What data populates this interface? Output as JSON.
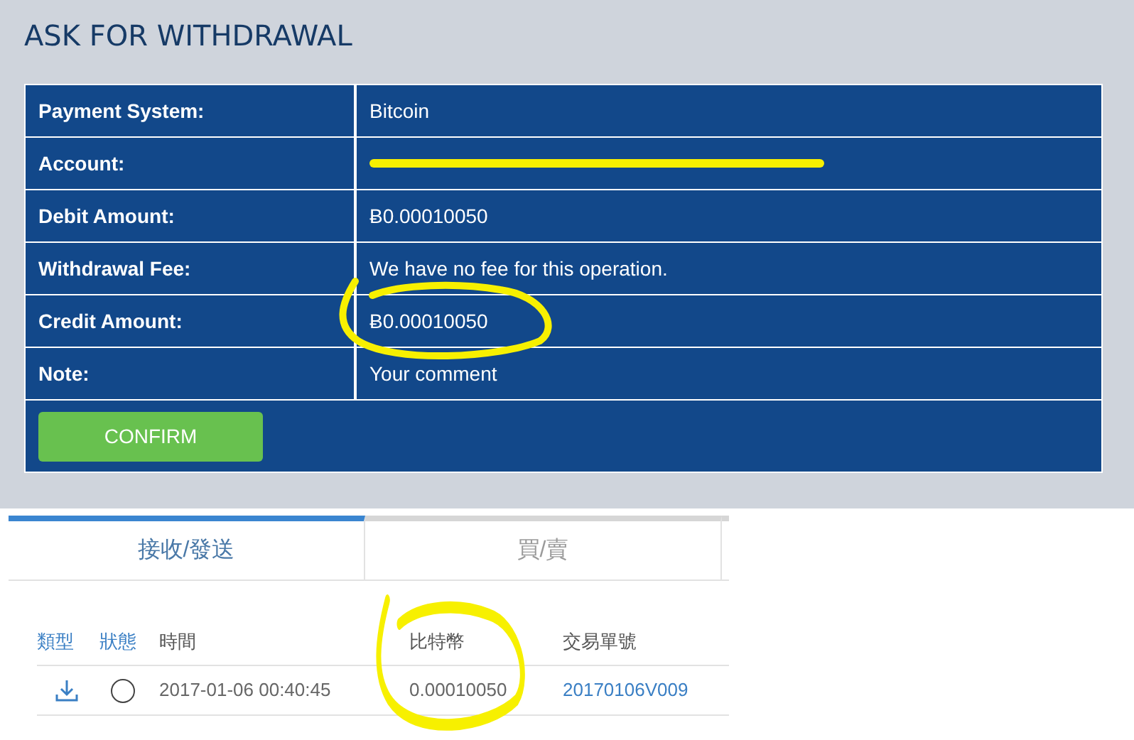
{
  "form": {
    "title": "ASK FOR WITHDRAWAL",
    "rows": [
      {
        "kind": "text",
        "label": "Payment System:",
        "value": "Bitcoin"
      },
      {
        "kind": "struck",
        "label": "Account:"
      },
      {
        "kind": "text",
        "label": "Debit Amount:",
        "value": "Ƀ0.00010050"
      },
      {
        "kind": "text",
        "label": "Withdrawal Fee:",
        "value": "We have no fee for this operation."
      },
      {
        "kind": "circled",
        "label": "Credit Amount:",
        "value": "Ƀ0.00010050"
      },
      {
        "kind": "input",
        "label": "Note:",
        "placeholder": "Your comment"
      }
    ],
    "button": "CONFIRM"
  },
  "history": {
    "tabs": [
      {
        "label": "接收/發送",
        "selected": true
      },
      {
        "label": "買/賣",
        "selected": false
      }
    ],
    "columns": [
      {
        "label": "類型",
        "accent": true
      },
      {
        "label": "狀態",
        "accent": true
      },
      {
        "label": "時間",
        "accent": false
      },
      {
        "label": "比特幣",
        "accent": false,
        "circled": true
      },
      {
        "label": "交易單號",
        "accent": false
      }
    ],
    "rows": [
      {
        "kind": "receive",
        "done": false,
        "time": "2017-01-06 00:40:45",
        "amount": "0.00010050",
        "tx": "20170106V009"
      }
    ]
  }
}
